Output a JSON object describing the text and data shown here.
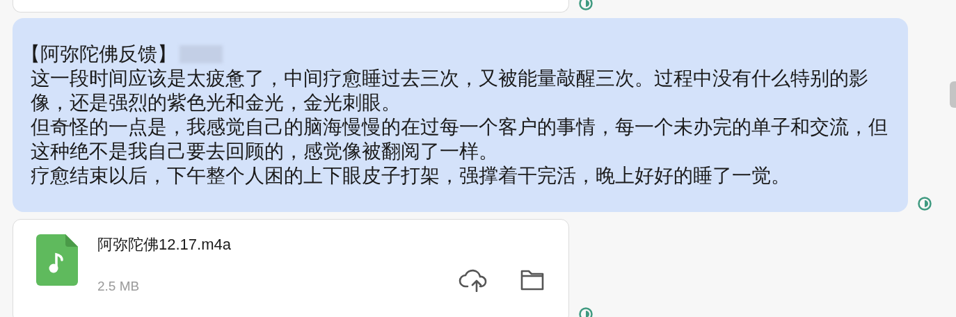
{
  "messages": [
    {
      "kind": "card_edge",
      "read": false
    },
    {
      "kind": "text",
      "title": "【阿弥陀佛反馈】",
      "redacted": true,
      "paragraphs": [
        "这一段时间应该是太疲惫了，中间疗愈睡过去三次，又被能量敲醒三次。过程中没有什么特别的影像，还是强烈的紫色光和金光，金光刺眼。",
        "但奇怪的一点是，我感觉自己的脑海慢慢的在过每一个客户的事情，每一个未办完的单子和交流，但这种绝不是我自己要去回顾的，感觉像被翻阅了一样。",
        "疗愈结束以后，下午整个人困的上下眼皮子打架，强撑着干完活，晚上好好的睡了一觉。"
      ],
      "read": false
    },
    {
      "kind": "file",
      "file_name": "阿弥陀佛12.17.m4a",
      "size": "2.5 MB",
      "read": false
    }
  ]
}
